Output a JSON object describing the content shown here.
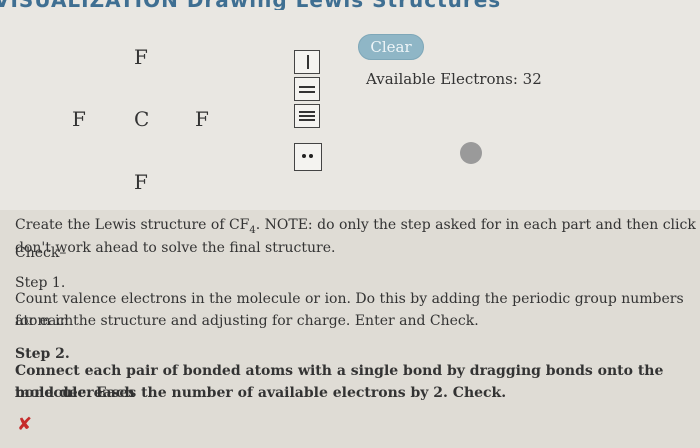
{
  "header": {
    "title_fragment": "VISUALIZATION Drawing Lewis Structures"
  },
  "molecule": {
    "atoms": [
      "F",
      "F",
      "C",
      "F",
      "F"
    ]
  },
  "controls": {
    "clear_label": "Clear",
    "available_electrons_label": "Available Electrons: 32"
  },
  "tools": [
    {
      "name": "single-bond-tool"
    },
    {
      "name": "double-bond-tool"
    },
    {
      "name": "triple-bond-tool"
    },
    {
      "name": "lone-pair-tool"
    }
  ],
  "instructions": {
    "intro_line1": "Create the Lewis structure of CF",
    "intro_subscript": "4",
    "intro_line1_rest": ". NOTE: do only the step asked for in each part and then click Check–",
    "intro_line2": "don't work ahead to solve the final structure.",
    "step1_title": "Step 1.",
    "step1_line1": "Count valence electrons in the molecule or ion. Do this by adding the periodic group numbers for each",
    "step1_line2": "atom in the structure and adjusting for charge. Enter and Check.",
    "step2_title": "Step 2.",
    "step2_line1": "Connect each pair of bonded atoms with a single bond by dragging bonds onto the molecule. Each",
    "step2_line2": "bond decreases the number of available electrons by 2. Check.",
    "status_mark": "✘"
  }
}
